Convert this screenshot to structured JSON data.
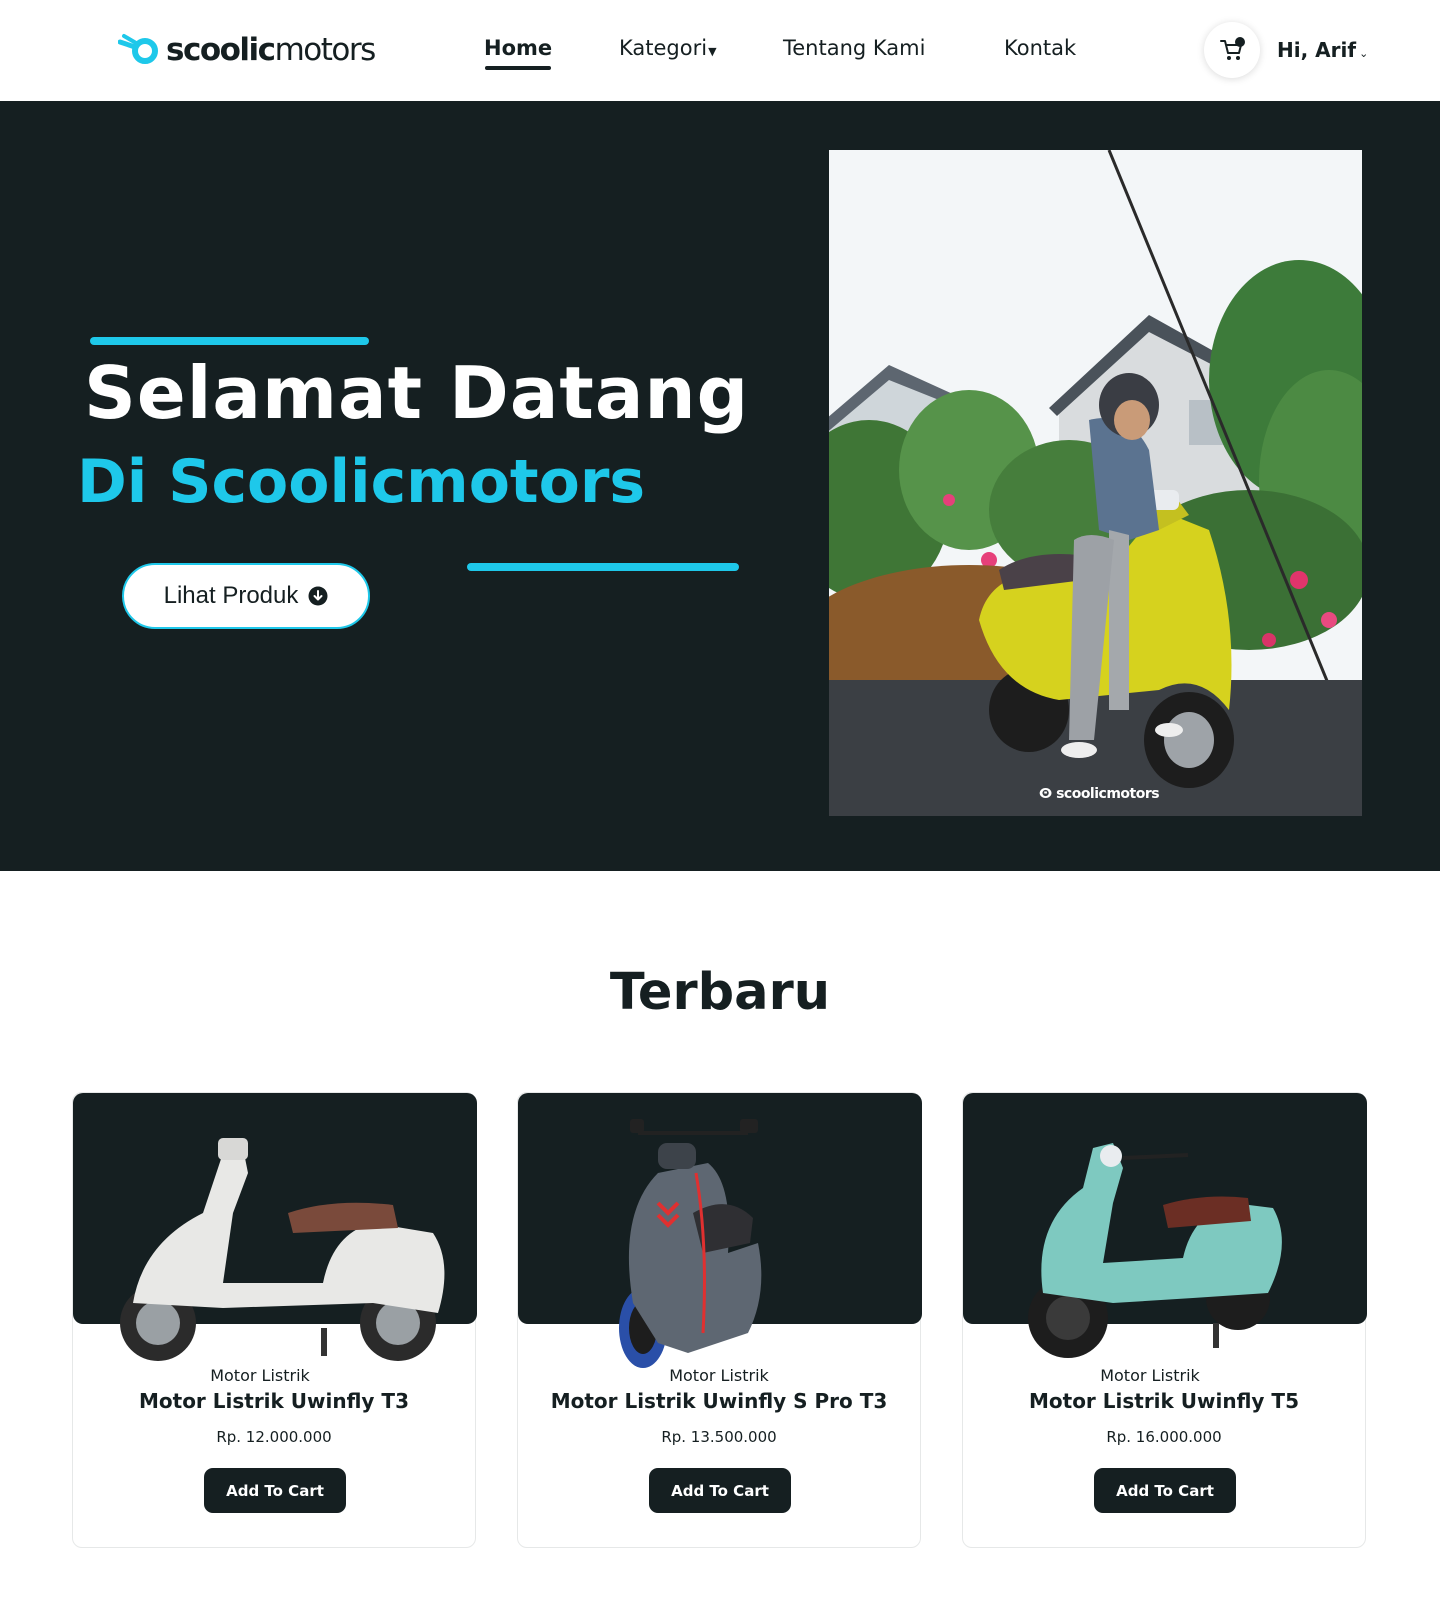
{
  "brand": {
    "name_bold": "scoolic",
    "name_light": "motors",
    "accent_color": "#1ec8ea",
    "dark_color": "#151f21"
  },
  "nav": {
    "items": [
      {
        "label": "Home",
        "active": true
      },
      {
        "label": "Kategori",
        "has_dropdown": true
      },
      {
        "label": "Tentang Kami"
      },
      {
        "label": "Kontak"
      }
    ],
    "cart_icon": "cart-icon",
    "user_greeting": "Hi, Arif"
  },
  "hero": {
    "title": "Selamat Datang",
    "subtitle": "Di Scoolicmotors",
    "cta_label": "Lihat Produk",
    "cta_icon": "arrow-down-circle-icon",
    "photo_watermark": "scoolicmotors"
  },
  "section": {
    "title": "Terbaru",
    "products": [
      {
        "category": "Motor Listrik",
        "name": "Motor Listrik Uwinfly T3",
        "price": "Rp. 12.000.000",
        "button": "Add To Cart",
        "scooter_color": "#e8e8e6"
      },
      {
        "category": "Motor Listrik",
        "name": "Motor Listrik Uwinfly S Pro T3",
        "price": "Rp. 13.500.000",
        "button": "Add To Cart",
        "scooter_color": "#5e6772"
      },
      {
        "category": "Motor Listrik",
        "name": "Motor Listrik Uwinfly T5",
        "price": "Rp. 16.000.000",
        "button": "Add To Cart",
        "scooter_color": "#7ec9c0"
      }
    ]
  }
}
